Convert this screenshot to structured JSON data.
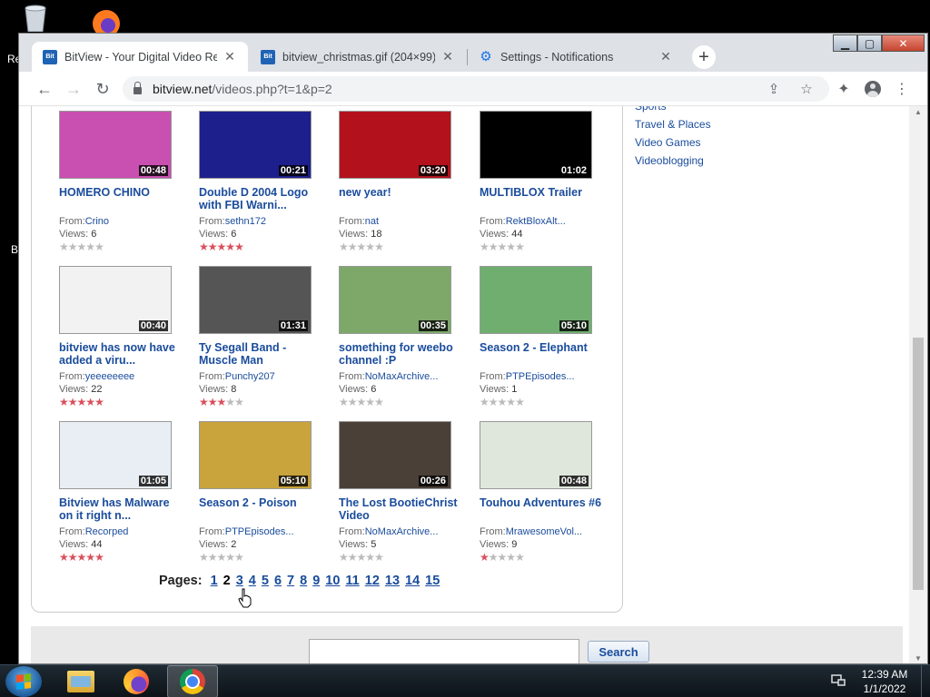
{
  "desktop": {
    "label_re": "Re",
    "label_b": "B"
  },
  "tabs": [
    {
      "favicon": "BitView",
      "title": "BitView - Your Digital Video Repository"
    },
    {
      "favicon": "BitView",
      "title": "bitview_christmas.gif (204×99)"
    },
    {
      "favicon": "gear-icon",
      "title": "Settings - Notifications"
    }
  ],
  "address": {
    "host": "bitview.net",
    "path": "/videos.php?t=1&p=2"
  },
  "videos": [
    {
      "title": "HOMERO CHINO",
      "duration": "00:48",
      "from_label": "From:",
      "user": "Crino",
      "views_label": "Views:",
      "views": "6",
      "rating": 0,
      "thumb_color": "#c94fb0"
    },
    {
      "title": "Double D 2004 Logo with FBI Warni...",
      "duration": "00:21",
      "from_label": "From:",
      "user": "sethn172",
      "views_label": "Views:",
      "views": "6",
      "rating": 5,
      "thumb_color": "#1d1f8c"
    },
    {
      "title": "new year!",
      "duration": "03:20",
      "from_label": "From:",
      "user": "nat",
      "views_label": "Views:",
      "views": "18",
      "rating": 0,
      "thumb_color": "#b3121c"
    },
    {
      "title": "MULTIBLOX Trailer",
      "duration": "01:02",
      "from_label": "From:",
      "user": "RektBloxAlt...",
      "views_label": "Views:",
      "views": "44",
      "rating": 0,
      "thumb_color": "#000000"
    },
    {
      "title": "bitview has now have added a viru...",
      "duration": "00:40",
      "from_label": "From:",
      "user": "yeeeeeeee",
      "views_label": "Views:",
      "views": "22",
      "rating": 5,
      "thumb_color": "#f2f2f2"
    },
    {
      "title": "Ty Segall Band - Muscle Man",
      "duration": "01:31",
      "from_label": "From:",
      "user": "Punchy207",
      "views_label": "Views:",
      "views": "8",
      "rating": 3,
      "thumb_color": "#555555"
    },
    {
      "title": "something for weebo channel :P",
      "duration": "00:35",
      "from_label": "From:",
      "user": "NoMaxArchive...",
      "views_label": "Views:",
      "views": "6",
      "rating": 0,
      "thumb_color": "#7da86a"
    },
    {
      "title": "Season 2 - Elephant",
      "duration": "05:10",
      "from_label": "From:",
      "user": "PTPEpisodes...",
      "views_label": "Views:",
      "views": "1",
      "rating": 0,
      "thumb_color": "#6fae6f"
    },
    {
      "title": "Bitview has Malware on it right n...",
      "duration": "01:05",
      "from_label": "From:",
      "user": "Recorped",
      "views_label": "Views:",
      "views": "44",
      "rating": 4.5,
      "thumb_color": "#e8eef4"
    },
    {
      "title": "Season 2 - Poison",
      "duration": "05:10",
      "from_label": "From:",
      "user": "PTPEpisodes...",
      "views_label": "Views:",
      "views": "2",
      "rating": 0,
      "thumb_color": "#c9a33b"
    },
    {
      "title": "The Lost BootieChrist Video",
      "duration": "00:26",
      "from_label": "From:",
      "user": "NoMaxArchive...",
      "views_label": "Views:",
      "views": "5",
      "rating": 0,
      "thumb_color": "#4a4038"
    },
    {
      "title": "Touhou Adventures #6",
      "duration": "00:48",
      "from_label": "From:",
      "user": "MrawesomeVol...",
      "views_label": "Views:",
      "views": "9",
      "rating": 1,
      "thumb_color": "#dfe7dc"
    }
  ],
  "pager": {
    "label": "Pages:",
    "current": "2",
    "pages": [
      "1",
      "2",
      "3",
      "4",
      "5",
      "6",
      "7",
      "8",
      "9",
      "10",
      "11",
      "12",
      "13",
      "14",
      "15"
    ]
  },
  "categories": [
    "Sports",
    "Travel & Places",
    "Video Games",
    "Videoblogging"
  ],
  "search": {
    "button_label": "Search",
    "value": ""
  },
  "taskbar": {
    "time": "12:39 AM",
    "date": "1/1/2022"
  },
  "colors": {
    "link": "#1a4c9c",
    "star_on": "#d9505c",
    "star_off": "#bbbbbb"
  }
}
